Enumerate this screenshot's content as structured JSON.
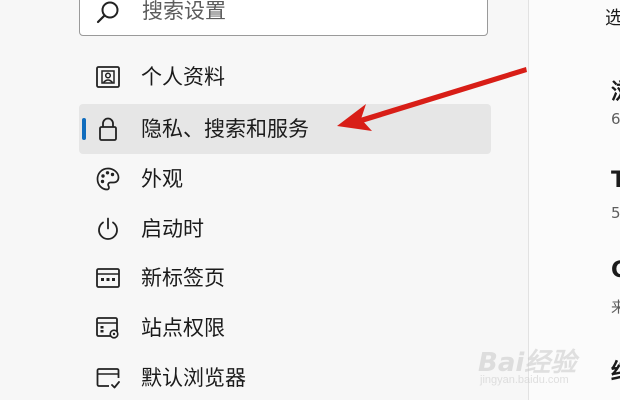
{
  "search": {
    "placeholder": "搜索设置"
  },
  "sidebar": {
    "items": [
      {
        "label": "个人资料",
        "icon": "profile-icon",
        "selected": false
      },
      {
        "label": "隐私、搜索和服务",
        "icon": "lock-icon",
        "selected": true
      },
      {
        "label": "外观",
        "icon": "palette-icon",
        "selected": false
      },
      {
        "label": "启动时",
        "icon": "power-icon",
        "selected": false
      },
      {
        "label": "新标签页",
        "icon": "new-tab-icon",
        "selected": false
      },
      {
        "label": "站点权限",
        "icon": "site-permissions-icon",
        "selected": false
      },
      {
        "label": "默认浏览器",
        "icon": "default-browser-icon",
        "selected": false
      }
    ]
  },
  "content": {
    "fragments": [
      "选",
      "浏",
      "6",
      "T",
      "5",
      "C",
      "来",
      "结"
    ]
  },
  "watermark": {
    "text": "Bai经验",
    "sub": "jingyan.baidu.com"
  },
  "colors": {
    "accent": "#0f6cbd",
    "selected_bg": "#e6e6e6",
    "arrow": "#e0211b",
    "background": "#f7f7f7"
  }
}
